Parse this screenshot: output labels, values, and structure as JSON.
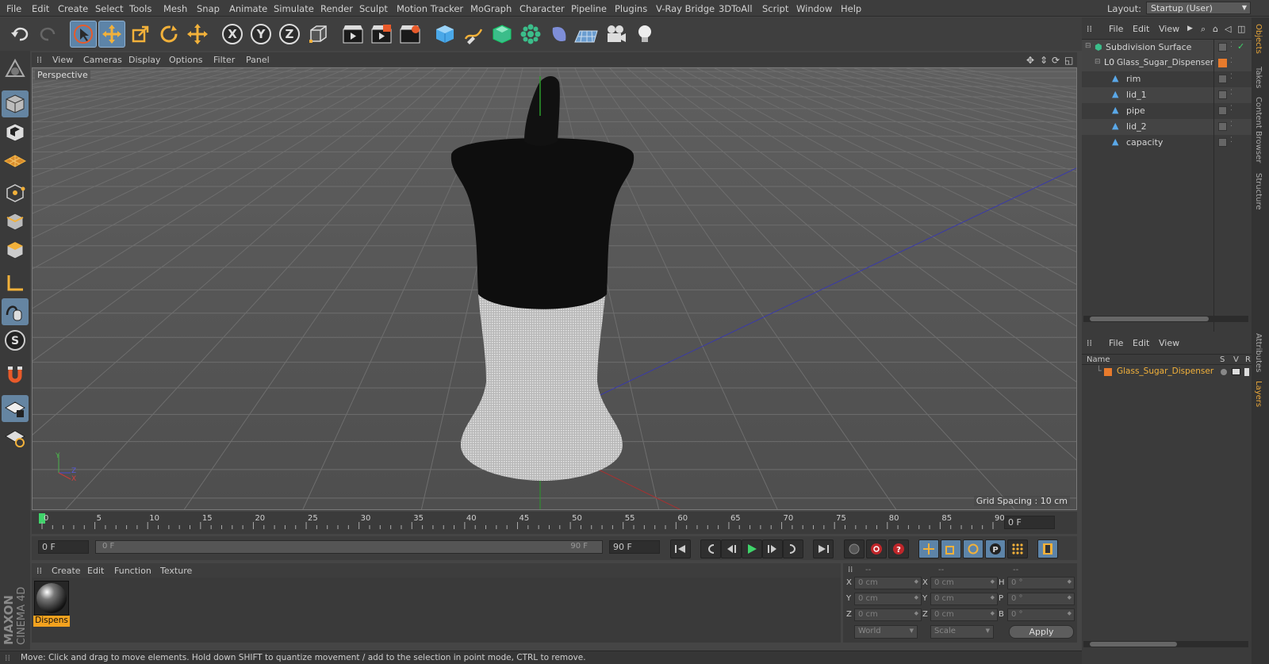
{
  "menubar": {
    "items": [
      "File",
      "Edit",
      "Create",
      "Select",
      "Tools",
      "Mesh",
      "Snap",
      "Animate",
      "Simulate",
      "Render",
      "Sculpt",
      "Motion Tracker",
      "MoGraph",
      "Character",
      "Pipeline",
      "Plugins",
      "V-Ray Bridge",
      "3DToAll",
      "Script",
      "Window",
      "Help"
    ],
    "layout_label": "Layout:",
    "layout_value": "Startup (User)"
  },
  "toolbar": {
    "icons": [
      "undo-icon",
      "redo-icon",
      "live-select-icon",
      "move-icon",
      "scale-icon",
      "rotate-icon",
      "transform-icon",
      "x-axis-icon",
      "y-axis-icon",
      "z-axis-icon",
      "coordinate-system-icon",
      "render-view-icon",
      "render-picture-viewer-icon",
      "render-settings-icon",
      "cube-icon",
      "pen-icon",
      "subdivision-icon",
      "cloner-icon",
      "deformer-icon",
      "floor-icon",
      "camera-icon",
      "light-icon"
    ],
    "axis_labels": [
      "X",
      "Y",
      "Z"
    ]
  },
  "left_tools": [
    "make-editable-icon",
    "model-mode-icon",
    "texture-mode-icon",
    "workplane-icon",
    "points-mode-icon",
    "edges-mode-icon",
    "polygons-mode-icon",
    "axis-mode-icon",
    "tweak-icon",
    "snap-icon",
    "magnet-icon",
    "lock-workplane-icon",
    "locked-workplane-icon"
  ],
  "viewport": {
    "menu": [
      "View",
      "Cameras",
      "Display",
      "Options",
      "Filter",
      "Panel"
    ],
    "camera_label": "Perspective",
    "grid_spacing": "Grid Spacing : 10 cm",
    "axis_labels": {
      "y": "Y",
      "z": "Z",
      "x": "X"
    }
  },
  "timeline": {
    "ticks": [
      "0",
      "5",
      "10",
      "15",
      "20",
      "25",
      "30",
      "35",
      "40",
      "45",
      "50",
      "55",
      "60",
      "65",
      "70",
      "75",
      "80",
      "85",
      "90"
    ],
    "current_frame": "0 F"
  },
  "transport": {
    "start_field": "0 F",
    "range_start": "0 F",
    "range_end": "90 F",
    "end_field": "90 F"
  },
  "material_panel": {
    "menu": [
      "Create",
      "Edit",
      "Function",
      "Texture"
    ],
    "material_name": "Dispens"
  },
  "coords": {
    "header": [
      "--",
      "--",
      "--"
    ],
    "rows": [
      {
        "a": "X",
        "av": "0 cm",
        "b": "X",
        "bv": "0 cm",
        "c": "H",
        "cv": "0 °"
      },
      {
        "a": "Y",
        "av": "0 cm",
        "b": "Y",
        "bv": "0 cm",
        "c": "P",
        "cv": "0 °"
      },
      {
        "a": "Z",
        "av": "0 cm",
        "b": "Z",
        "bv": "0 cm",
        "c": "B",
        "cv": "0 °"
      }
    ],
    "mode_left": "World",
    "mode_right": "Scale",
    "apply_label": "Apply"
  },
  "status": "Move: Click and drag to move elements. Hold down SHIFT to quantize movement / add to the selection in point mode, CTRL to remove.",
  "brand": {
    "maker": "MAXON",
    "product": "CINEMA 4D"
  },
  "object_manager": {
    "menu": [
      "File",
      "Edit",
      "View"
    ],
    "objects": [
      {
        "name": "Subdivision Surface",
        "level": 0
      },
      {
        "name": "Glass_Sugar_Dispenser",
        "level": 1
      },
      {
        "name": "rim",
        "level": 2
      },
      {
        "name": "lid_1",
        "level": 2
      },
      {
        "name": "pipe",
        "level": 2
      },
      {
        "name": "lid_2",
        "level": 2
      },
      {
        "name": "capacity",
        "level": 2
      }
    ]
  },
  "layer_manager": {
    "menu": [
      "File",
      "Edit",
      "View"
    ],
    "columns": [
      "Name",
      "S",
      "V",
      "R"
    ],
    "layer_name": "Glass_Sugar_Dispenser"
  },
  "side_tabs": [
    "Objects",
    "Takes",
    "Content Browser",
    "Structure",
    "Attributes",
    "Layers"
  ],
  "colors": {
    "accent": "#f3a21f",
    "selection": "#5d84a8",
    "layer": "#e87b2c",
    "active_tab": "#e6a53a"
  }
}
